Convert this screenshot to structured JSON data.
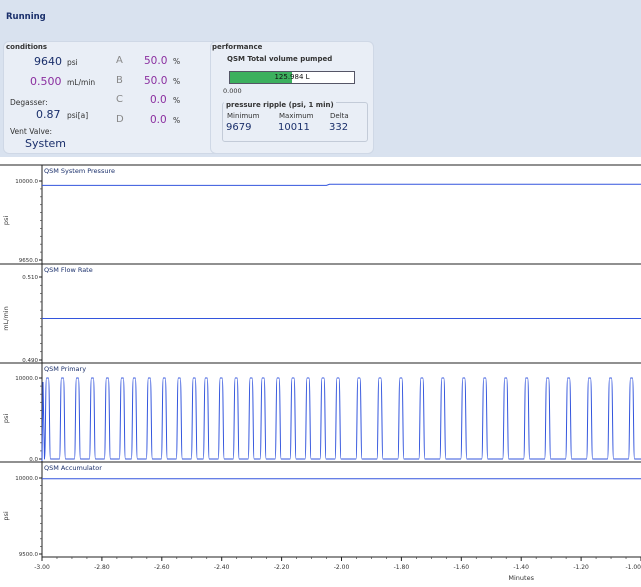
{
  "status": "Running",
  "conditions": {
    "title": "conditions",
    "pressure": {
      "value": "9640",
      "unit": "psi"
    },
    "flow": {
      "value": "0.500",
      "unit": "mL/min"
    },
    "degasser": {
      "label": "Degasser:",
      "value": "0.87",
      "unit": "psi[a]"
    },
    "vent": {
      "label": "Vent Valve:",
      "value": "System"
    },
    "solvents": [
      {
        "letter": "A",
        "value": "50.0",
        "unit": "%"
      },
      {
        "letter": "B",
        "value": "50.0",
        "unit": "%"
      },
      {
        "letter": "C",
        "value": "0.0",
        "unit": "%"
      },
      {
        "letter": "D",
        "value": "0.0",
        "unit": "%"
      }
    ]
  },
  "performance": {
    "title": "performance",
    "volume_label": "QSM Total volume pumped",
    "volume_value": "125.984 L",
    "volume_fraction": 0.5,
    "volume_min": "0.000",
    "ripple": {
      "title": "pressure ripple (psi, 1 min)",
      "headers": [
        "Minimum",
        "Maximum",
        "Delta"
      ],
      "values": [
        "9679",
        "10011",
        "332"
      ]
    }
  },
  "colors": {
    "trace": "#3355dd",
    "accent": "#1a2f6b",
    "value": "#8b2fa0",
    "bar": "#3cb05e"
  },
  "chart_data": [
    {
      "type": "line",
      "title": "QSM System Pressure",
      "ylabel": "psi",
      "ytick_labels": [
        "10000.0",
        "9650.0"
      ],
      "ylim": [
        9650,
        10010
      ],
      "x": [
        -3.0,
        -2.05,
        -2.04,
        -1.0
      ],
      "y": [
        9990,
        9990,
        9995,
        9995
      ]
    },
    {
      "type": "line",
      "title": "QSM Flow Rate",
      "ylabel": "mL/min",
      "ytick_labels": [
        "0.510",
        "0.490"
      ],
      "ylim": [
        0.49,
        0.51
      ],
      "x": [
        -3.0,
        -1.0
      ],
      "y": [
        0.5,
        0.5
      ]
    },
    {
      "type": "line",
      "title": "QSM Primary",
      "ylabel": "psi",
      "ytick_labels": [
        "10000.0",
        "0.0"
      ],
      "ylim": [
        0,
        10000
      ],
      "pulses": [
        -2.99,
        -2.94,
        -2.89,
        -2.84,
        -2.79,
        -2.74,
        -2.7,
        -2.65,
        -2.6,
        -2.55,
        -2.5,
        -2.46,
        -2.41,
        -2.36,
        -2.31,
        -2.27,
        -2.22,
        -2.17,
        -2.12,
        -2.07,
        -2.02,
        -1.95,
        -1.88,
        -1.81,
        -1.74,
        -1.67,
        -1.6,
        -1.53,
        -1.46,
        -1.39,
        -1.32,
        -1.25,
        -1.18,
        -1.11,
        -1.04
      ]
    },
    {
      "type": "line",
      "title": "QSM Accumulator",
      "ylabel": "psi",
      "ytick_labels": [
        "10000.0",
        "9500.0"
      ],
      "ylim": [
        9500,
        10000
      ],
      "x": [
        -3.0,
        -1.0
      ],
      "y": [
        9995,
        9995
      ]
    }
  ],
  "x_axis": {
    "label": "Minutes",
    "ticks": [
      -3.0,
      -2.8,
      -2.6,
      -2.4,
      -2.2,
      -2.0,
      -1.8,
      -1.6,
      -1.4,
      -1.2,
      -1.0
    ],
    "tick_labels": [
      "-3.00",
      "-2.80",
      "-2.60",
      "-2.40",
      "-2.20",
      "-2.00",
      "-1.80",
      "-1.60",
      "-1.40",
      "-1.20",
      "-1.00"
    ]
  }
}
